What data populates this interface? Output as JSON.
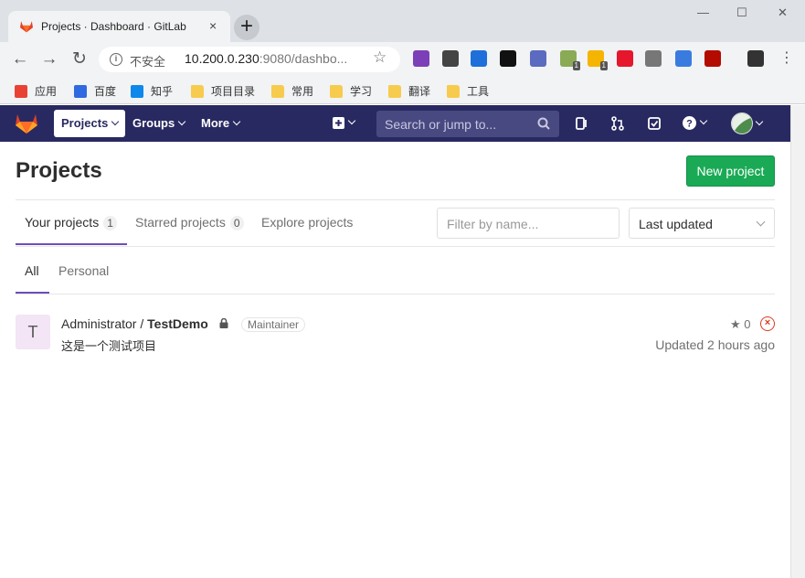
{
  "browser": {
    "tab_title": "Projects · Dashboard · GitLab",
    "tab_close": "×",
    "new_tab": "+",
    "window": {
      "minimize": "—",
      "maximize": "☐",
      "close": "✕"
    },
    "address": {
      "security_label": "不安全",
      "host": "10.200.0.230",
      "rest": ":9080/dashbo..."
    },
    "extensions": [
      {
        "icon": "rp-icon",
        "color": "#7b3fb8"
      },
      {
        "icon": "m-icon",
        "color": "#444444"
      },
      {
        "icon": "translate-icon",
        "color": "#1e6fd9"
      },
      {
        "icon": "media-icon",
        "color": "#111111"
      },
      {
        "icon": "search-ext-icon",
        "color": "#5b6bbf"
      },
      {
        "icon": "g-icon",
        "color": "#8aaa55",
        "badge": "1"
      },
      {
        "icon": "chat-icon",
        "color": "#f5b400",
        "badge": "1"
      },
      {
        "icon": "weibo-icon",
        "color": "#e6162d"
      },
      {
        "icon": "gear-ext-icon",
        "color": "#777777"
      },
      {
        "icon": "bird-icon",
        "color": "#3a7be0"
      },
      {
        "icon": "pdf-icon",
        "color": "#b30b00"
      },
      {
        "icon": "user-ext-icon",
        "color": "#333333"
      }
    ],
    "bookmarks": [
      {
        "label": "应用",
        "icon": "apps-icon"
      },
      {
        "label": "百度",
        "icon": "baidu-icon"
      },
      {
        "label": "知乎",
        "icon": "zhihu-icon"
      },
      {
        "label": "项目目录",
        "icon": "folder-icon"
      },
      {
        "label": "常用",
        "icon": "folder-icon"
      },
      {
        "label": "学习",
        "icon": "folder-icon"
      },
      {
        "label": "翻译",
        "icon": "folder-icon"
      },
      {
        "label": "工具",
        "icon": "folder-icon"
      }
    ]
  },
  "navbar": {
    "brand_color": "#292961",
    "items": [
      "Projects",
      "Groups",
      "More"
    ],
    "search_placeholder": "Search or jump to..."
  },
  "page": {
    "title": "Projects",
    "new_project_label": "New project",
    "tabs": [
      {
        "label": "Your projects",
        "count": "1",
        "active": true
      },
      {
        "label": "Starred projects",
        "count": "0",
        "active": false
      },
      {
        "label": "Explore projects",
        "active": false
      }
    ],
    "filter_placeholder": "Filter by name...",
    "sort_value": "Last updated",
    "subtabs": [
      {
        "label": "All",
        "active": true
      },
      {
        "label": "Personal",
        "active": false
      }
    ],
    "projects": [
      {
        "avatar_letter": "T",
        "namespace": "Administrator / ",
        "name": "TestDemo",
        "role": "Maintainer",
        "description": "这是一个测试项目",
        "stars": "0",
        "updated": "Updated 2 hours ago"
      }
    ]
  }
}
